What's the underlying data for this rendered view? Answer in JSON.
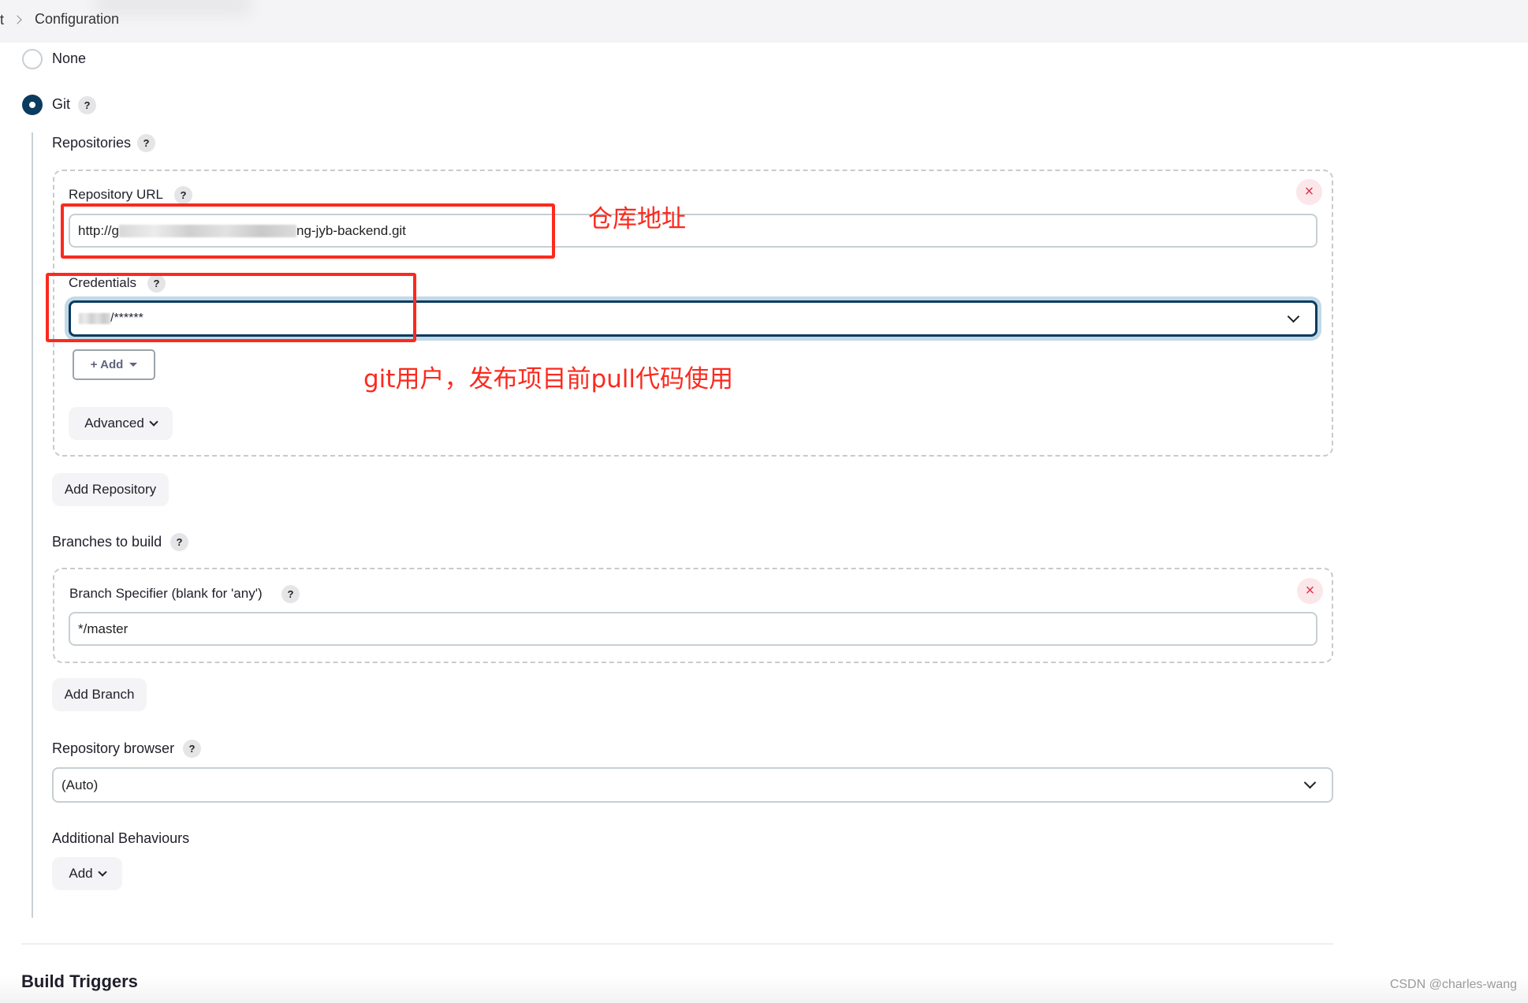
{
  "breadcrumb": {
    "previous": "t",
    "current": "Configuration"
  },
  "scm": {
    "options": [
      {
        "label": "None",
        "selected": false
      },
      {
        "label": "Git",
        "selected": true
      }
    ],
    "help": "?"
  },
  "repositories": {
    "label": "Repositories",
    "repository_url": {
      "label": "Repository URL",
      "value_prefix": "http://g",
      "value_suffix": "ng-jyb-backend.git"
    },
    "credentials": {
      "label": "Credentials",
      "value_suffix": "/******"
    },
    "add_button": "+ Add",
    "advanced_button": "Advanced",
    "add_repository_button": "Add Repository",
    "delete_icon": "×"
  },
  "branches": {
    "label": "Branches to build",
    "specifier_label": "Branch Specifier (blank for 'any')",
    "specifier_value": "*/master",
    "add_branch_button": "Add Branch",
    "delete_icon": "×"
  },
  "repository_browser": {
    "label": "Repository browser",
    "value": "(Auto)"
  },
  "additional_behaviours": {
    "label": "Additional Behaviours",
    "add_button": "Add"
  },
  "next_section": {
    "title": "Build Triggers"
  },
  "annotations": {
    "repo_address": "仓库地址",
    "git_user": "git用户，发布项目前pull代码使用",
    "color": "#fb2a1e"
  },
  "watermark": "CSDN @charles-wang",
  "colors": {
    "radio_selected": "#0b3b5f",
    "focus_ring": "#c2d9e7",
    "delete_red": "#e0334b"
  }
}
